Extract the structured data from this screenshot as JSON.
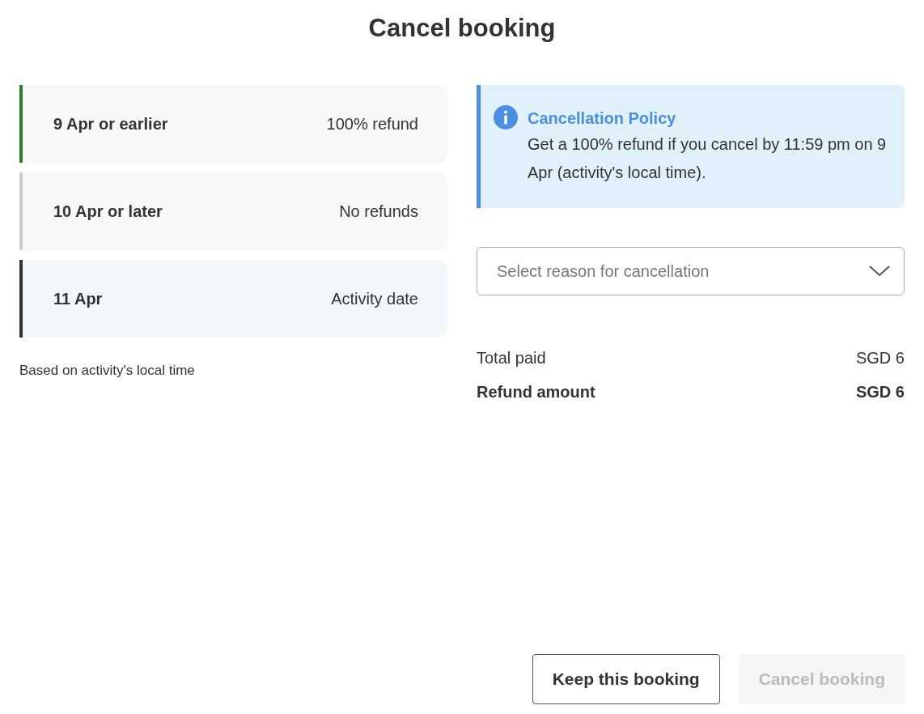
{
  "title": "Cancel booking",
  "timeline": [
    {
      "date": "9 Apr or earlier",
      "outcome": "100% refund",
      "color": "#2e7d32",
      "kind": "deadline"
    },
    {
      "date": "10 Apr or later",
      "outcome": "No refunds",
      "color": "#cccccc",
      "kind": "deadline"
    },
    {
      "date": "11 Apr",
      "outcome": "Activity date",
      "color": "#333333",
      "kind": "activity"
    }
  ],
  "timeline_note": "Based on activity's local time",
  "policy": {
    "title": "Cancellation Policy",
    "text": "Get a 100% refund if you cancel by 11:59 pm on 9 Apr (activity's local time)."
  },
  "reason_select": {
    "placeholder": "Select reason for cancellation"
  },
  "totals": [
    {
      "label": "Total paid",
      "value": "SGD 6",
      "kind": "normal"
    },
    {
      "label": "Refund amount",
      "value": "SGD 6",
      "kind": "emphasis"
    }
  ],
  "buttons": [
    {
      "label": "Keep this booking",
      "kind": "secondary",
      "disabled": false
    },
    {
      "label": "Cancel booking",
      "kind": "primary",
      "disabled": true
    }
  ]
}
